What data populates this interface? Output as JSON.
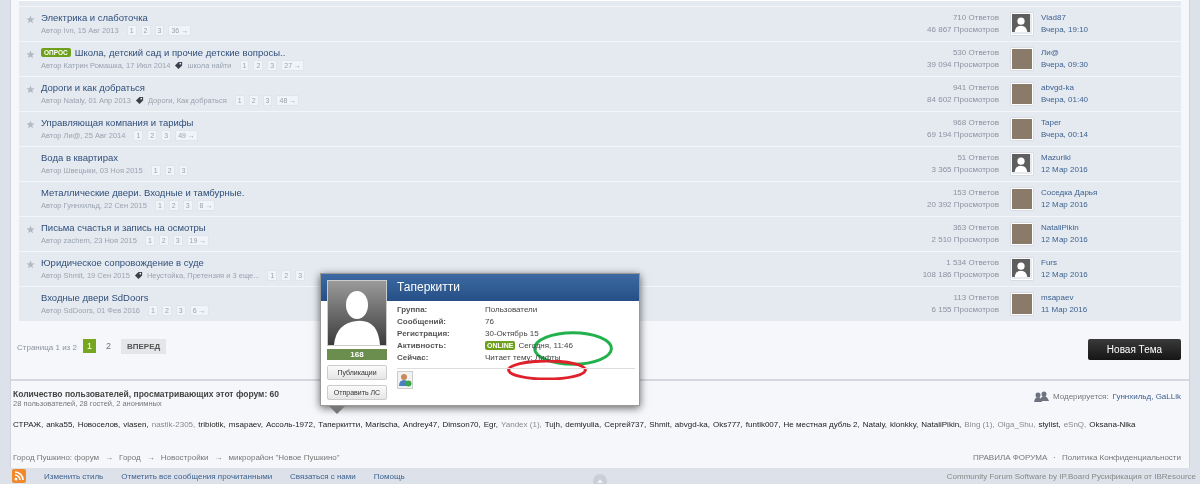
{
  "topics": [
    {
      "starred": true,
      "title": "Электрика и слаботочка",
      "author": "Автор Ivn, 15 Авг 2013",
      "pages": [
        "1",
        "2",
        "3",
        "36 →"
      ],
      "replies": "710 Ответов",
      "views": "46 867 Просмотров",
      "last_avatar": {
        "kind": "silhouette"
      },
      "last_poster": "Vlad87",
      "last_time": "Вчера, 19:10"
    },
    {
      "starred": true,
      "badge": "ОПРОС",
      "title": "Школа, детский сад и прочие детские вопросы..",
      "author": "Автор Катрин Ромашка, 17 Июл 2014",
      "tags": "школа найти",
      "pages": [
        "1",
        "2",
        "3",
        "27 →"
      ],
      "replies": "530 Ответов",
      "views": "39 094 Просмотров",
      "last_avatar": {
        "kind": "photo"
      },
      "last_poster": "Ли@",
      "last_time": "Вчера, 09:30"
    },
    {
      "starred": true,
      "title": "Дороги и как добраться",
      "author": "Автор Nataly, 01 Апр 2013",
      "tags": "Дороги, Как добраться",
      "pages": [
        "1",
        "2",
        "3",
        "48 →"
      ],
      "replies": "941 Ответов",
      "views": "84 602 Просмотров",
      "last_avatar": {
        "kind": "photo"
      },
      "last_poster": "abvgd-ka",
      "last_time": "Вчера, 01:40"
    },
    {
      "starred": true,
      "title": "Управляющая компания и тарифы",
      "author": "Автор Ли@, 25 Авг 2014",
      "pages": [
        "1",
        "2",
        "3",
        "49 →"
      ],
      "replies": "968 Ответов",
      "views": "69 194 Просмотров",
      "last_avatar": {
        "kind": "photo"
      },
      "last_poster": "Taper",
      "last_time": "Вчера, 00:14"
    },
    {
      "starred": false,
      "title": "Вода в квартирах",
      "author": "Автор Швецыки, 03 Ноя 2015",
      "pages": [
        "1",
        "2",
        "3"
      ],
      "replies": "51 Ответов",
      "views": "3 365 Просмотров",
      "last_avatar": {
        "kind": "silhouette"
      },
      "last_poster": "Mazuriki",
      "last_time": "12 Мар 2016"
    },
    {
      "starred": false,
      "title": "Металлические двери. Входные и тамбурные.",
      "author": "Автор Гуннхильд, 22 Сен 2015",
      "pages": [
        "1",
        "2",
        "3",
        "8 →"
      ],
      "replies": "153 Ответов",
      "views": "20 392 Просмотров",
      "last_avatar": {
        "kind": "photo"
      },
      "last_poster": "Соседка Дарья",
      "last_time": "12 Мар 2016"
    },
    {
      "starred": true,
      "title": "Письма счастья и запись на осмотры",
      "author": "Автор zachem, 23 Ноя 2015",
      "pages": [
        "1",
        "2",
        "3",
        "19 →"
      ],
      "replies": "363 Ответов",
      "views": "2 510 Просмотров",
      "last_avatar": {
        "kind": "photo"
      },
      "last_poster": "NataliPikin",
      "last_time": "12 Мар 2016"
    },
    {
      "starred": true,
      "title": "Юридическое сопровождение в суде",
      "author": "Автор Shmit, 19 Сен 2015",
      "tags": "Неустойка, Претензия и 3 еще...",
      "pages": [
        "1",
        "2",
        "3"
      ],
      "replies": "1 534 Ответов",
      "views": "108 186 Просмотров",
      "last_avatar": {
        "kind": "silhouette"
      },
      "last_poster": "Furs",
      "last_time": "12 Мар 2016"
    },
    {
      "starred": false,
      "title": "Входные двери SdDoors",
      "author": "Автор SdDoors, 01 Фев 2016",
      "pages": [
        "1",
        "2",
        "3",
        "6 →"
      ],
      "replies": "113 Ответов",
      "views": "6 155 Просмотров",
      "last_avatar": {
        "kind": "photo"
      },
      "last_poster": "msapaev",
      "last_time": "11 Мар 2016"
    }
  ],
  "pagination": {
    "label": "Страница 1 из 2",
    "pages": [
      {
        "label": "1",
        "selected": true
      },
      {
        "label": "2",
        "selected": false
      }
    ],
    "next": "ВПЕРЕД"
  },
  "new_topic_button": "Новая Тема",
  "popup": {
    "name": "Таперкитти",
    "reputation": "168",
    "buttons": [
      "Публикации",
      "Отправить ЛС"
    ],
    "fields": [
      {
        "label": "Группа:",
        "value": "Пользователи"
      },
      {
        "label": "Сообщений:",
        "value": "76"
      },
      {
        "label": "Регистрация:",
        "value": "30-Октябрь 15"
      },
      {
        "label": "Активность:",
        "value": "Сегодня, 11:46",
        "online": "ONLINE"
      },
      {
        "label": "Сейчас:",
        "value": "Читает тему: Лифты"
      }
    ],
    "annotations": [
      {
        "kind": "ellipse",
        "color": "#22b14c"
      },
      {
        "kind": "ellipse",
        "color": "#e0202a"
      }
    ]
  },
  "stats": {
    "title": "Количество пользователей, просматривающих этот форум: 60",
    "subtitle": "28 пользователей, 28 гостей, 2 анонимных",
    "moderated_label": "Модерируется:",
    "moderators": "Гуннхильд, GaLLik"
  },
  "online_users": [
    {
      "name": "СТРАЖ,",
      "kind": "member"
    },
    {
      "name": "anka55,",
      "kind": "member"
    },
    {
      "name": "Новоселов,",
      "kind": "member"
    },
    {
      "name": "viasen,",
      "kind": "member"
    },
    {
      "name": "nastik-2305,",
      "kind": "dim"
    },
    {
      "name": "tribiotik,",
      "kind": "member"
    },
    {
      "name": "msapaev,",
      "kind": "member"
    },
    {
      "name": "Ассоль-1972,",
      "kind": "member"
    },
    {
      "name": "Таперкитти,",
      "kind": "member"
    },
    {
      "name": "Marischa,",
      "kind": "member"
    },
    {
      "name": "Andrey47,",
      "kind": "member"
    },
    {
      "name": "Dimson70,",
      "kind": "member"
    },
    {
      "name": "Egr,",
      "kind": "member"
    },
    {
      "name": "Yandex (1),",
      "kind": "dim"
    },
    {
      "name": "Tujh,",
      "kind": "member"
    },
    {
      "name": "demiyulia,",
      "kind": "member"
    },
    {
      "name": "Сергей737,",
      "kind": "member"
    },
    {
      "name": "Shmit,",
      "kind": "member"
    },
    {
      "name": "abvgd-ka,",
      "kind": "member"
    },
    {
      "name": "Oks777,",
      "kind": "member"
    },
    {
      "name": "funtik007,",
      "kind": "member"
    },
    {
      "name": "Не местная дубль 2,",
      "kind": "member"
    },
    {
      "name": "Nataly,",
      "kind": "member"
    },
    {
      "name": "klonkky,",
      "kind": "member"
    },
    {
      "name": "NataliPikin,",
      "kind": "member"
    },
    {
      "name": "Bing (1),",
      "kind": "dim"
    },
    {
      "name": "Olga_Shu,",
      "kind": "dim"
    },
    {
      "name": "stylist,",
      "kind": "member"
    },
    {
      "name": "eSnQ,",
      "kind": "dim"
    },
    {
      "name": "Oksana-Nika",
      "kind": "member"
    }
  ],
  "breadcrumbs": [
    "Город Пушкино: форум",
    "Город",
    "Новостройки",
    "микрорайон \"Новое Пушкино\""
  ],
  "breadcrumb_separator": "→",
  "legal_links": [
    "ПРАВИЛА ФОРУМА",
    "Политика Конфиденциальности"
  ],
  "legal_separator": "·",
  "footer_links": [
    "Изменить стиль",
    "Отметить все сообщения прочитанными",
    "Связаться с нами",
    "Помощь"
  ],
  "copyright": "Community Forum Software by IP.Board Русификация от IBResource"
}
